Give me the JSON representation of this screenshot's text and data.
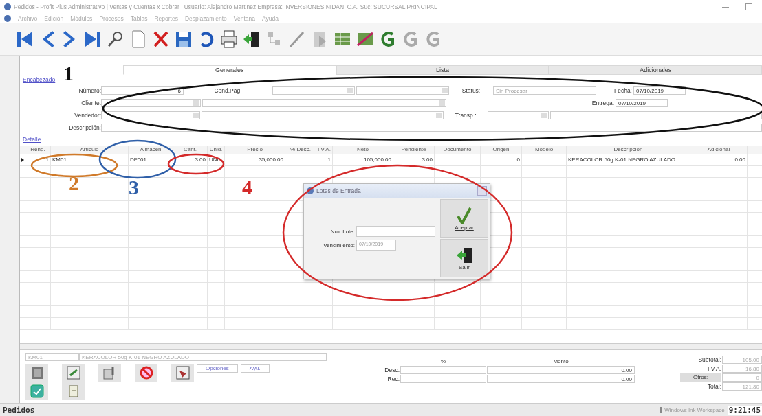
{
  "window": {
    "title": "Pedidos - Profit Plus Administrativo | Ventas y Cuentas x Cobrar | Usuario: Alejandro Martinez Empresa: INVERSIONES NIDAN, C.A. Suc: SUCURSAL PRINCIPAL"
  },
  "menu": [
    "Archivo",
    "Edición",
    "Módulos",
    "Procesos",
    "Tablas",
    "Reportes",
    "Desplazamiento",
    "Ventana",
    "Ayuda"
  ],
  "tabs": [
    {
      "label": "Generales",
      "selected": true
    },
    {
      "label": "Lista",
      "selected": false
    },
    {
      "label": "Adicionales",
      "selected": false
    }
  ],
  "header": {
    "section_label": "Encabezado",
    "numero_label": "Número:",
    "numero": "6",
    "cond_pag_label": "Cond.Pag.",
    "cliente_label": "Cliente:",
    "vendedor_label": "Vendedor:",
    "descripcion_label": "Descripción:",
    "status_label": "Status:",
    "status": "Sin Procesar",
    "transp_label": "Transp.:",
    "fecha_label": "Fecha:",
    "fecha": "07/10/2019",
    "entrega_label": "Entrega:",
    "entrega": "07/10/2019"
  },
  "detail_label": "Detalle",
  "table": {
    "columns": [
      "Reng.",
      "Artículo",
      "Almacén",
      "Cant.",
      "Unid.",
      "Precio",
      "% Desc.",
      "I.V.A.",
      "Neto",
      "Pendiente",
      "Documento",
      "Origen",
      "Modelo",
      "Descripción",
      "Adicional"
    ],
    "rows": [
      {
        "selected": true,
        "reng": "1",
        "articulo": "KM01",
        "almacen": "DF001",
        "cant": "3.00",
        "unid": "UND",
        "precio": "35,000.00",
        "iva": "1",
        "neto": "105,000.00",
        "pendiente": "3.00",
        "origen": "0",
        "descripcion": "KERACOLOR 50g K-01 NEGRO AZULADO",
        "adicional": "0.00"
      }
    ]
  },
  "dialog": {
    "title": "Lotes de Entrada",
    "lote_label": "Nro. Lote:",
    "vencimiento_label": "Vencimiento:",
    "vencimiento": "07/10/2019",
    "buttons": [
      {
        "kind": "accept",
        "label": "Aceptar"
      },
      {
        "kind": "exit",
        "label": "Salir"
      }
    ]
  },
  "footer": {
    "article_code": "KM01",
    "article_description": "KERACOLOR 50g K-01 NEGRO AZULADO",
    "link_buttons": [
      "Opciones",
      "Ayu."
    ],
    "pct_header": "%",
    "amount_header": "Monto",
    "desc_label": "Desc:",
    "desc_amount": "0.00",
    "rec_label": "Rec:",
    "rec_amount": "0.00",
    "subtotal_label": "Subtotal:",
    "subtotal": "105,00",
    "iva_label": "I.V.A.",
    "iva": "16,80",
    "otros_label": "Otros:",
    "otros": "0",
    "total_label": "Total:",
    "total": "121,80"
  },
  "status_bar": {
    "module": "Pedidos",
    "workspace": "Windows Ink Workspace",
    "time": "9:21:45"
  },
  "annotations": [
    {
      "number": "1",
      "color": "#111111"
    },
    {
      "number": "2",
      "color": "#d07a2a"
    },
    {
      "number": "3",
      "color": "#2f5fa8"
    },
    {
      "number": "4",
      "color": "#d42a2a"
    }
  ],
  "ellipses": [
    {
      "color": "#111111"
    },
    {
      "color": "#d07a2a"
    },
    {
      "color": "#2f5fa8"
    },
    {
      "color": "#d42a2a"
    },
    {
      "color": "#d42a2a"
    }
  ]
}
